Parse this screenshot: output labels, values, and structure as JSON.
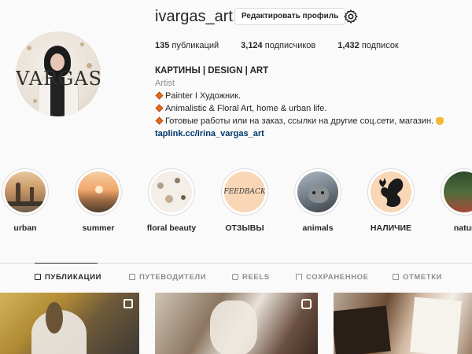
{
  "profile": {
    "username": "ivargas_art",
    "edit_button": "Редактировать профиль",
    "avatar_logo": "VARGAS",
    "stats": {
      "posts_value": "135",
      "posts_label": "публикаций",
      "followers_value": "3,124",
      "followers_label": "подписчиков",
      "following_value": "1,432",
      "following_label": "подписок"
    },
    "bio": {
      "name": "КАРТИНЫ | DESIGN | ART",
      "category": "Artist",
      "line1": "Painter I Художник.",
      "line2": "Animalistic & Floral Art, home & urban life.",
      "line3": "Готовые работы или на заказ, ссылки на другие соц.сети, магазин.",
      "link": "taplink.cc/irina_vargas_art"
    }
  },
  "highlights": [
    {
      "label": "urban",
      "icon": "city-bridge-image"
    },
    {
      "label": "summer",
      "icon": "sunset-field-image"
    },
    {
      "label": "floral beauty",
      "icon": "floral-painting-image"
    },
    {
      "label": "ОТЗЫВЫ",
      "icon": "feedback-text-image",
      "image_text": "FEEDBACK"
    },
    {
      "label": "animals",
      "icon": "leopard-image"
    },
    {
      "label": "НАЛИЧИЕ",
      "icon": "squirrel-silhouette-image"
    },
    {
      "label": "natur",
      "icon": "nature-image"
    }
  ],
  "tabs": [
    {
      "label": "ПУБЛИКАЦИИ",
      "icon": "grid-icon",
      "active": true
    },
    {
      "label": "ПУТЕВОДИТЕЛИ",
      "icon": "guide-icon",
      "active": false
    },
    {
      "label": "REELS",
      "icon": "reels-icon",
      "active": false
    },
    {
      "label": "СОХРАНЕННОЕ",
      "icon": "bookmark-icon",
      "active": false
    },
    {
      "label": "ОТМЕТКИ",
      "icon": "tag-icon",
      "active": false
    }
  ],
  "posts": [
    {
      "subject": "rabbit painting",
      "badge": "carousel-icon"
    },
    {
      "subject": "horses painting",
      "badge": "reel-icon"
    },
    {
      "subject": "horses photo collage",
      "badge": ""
    }
  ],
  "colors": {
    "accent_diamond": "#e56c1c",
    "link": "#00376b",
    "muted": "#8e8e8e",
    "text": "#262626"
  }
}
